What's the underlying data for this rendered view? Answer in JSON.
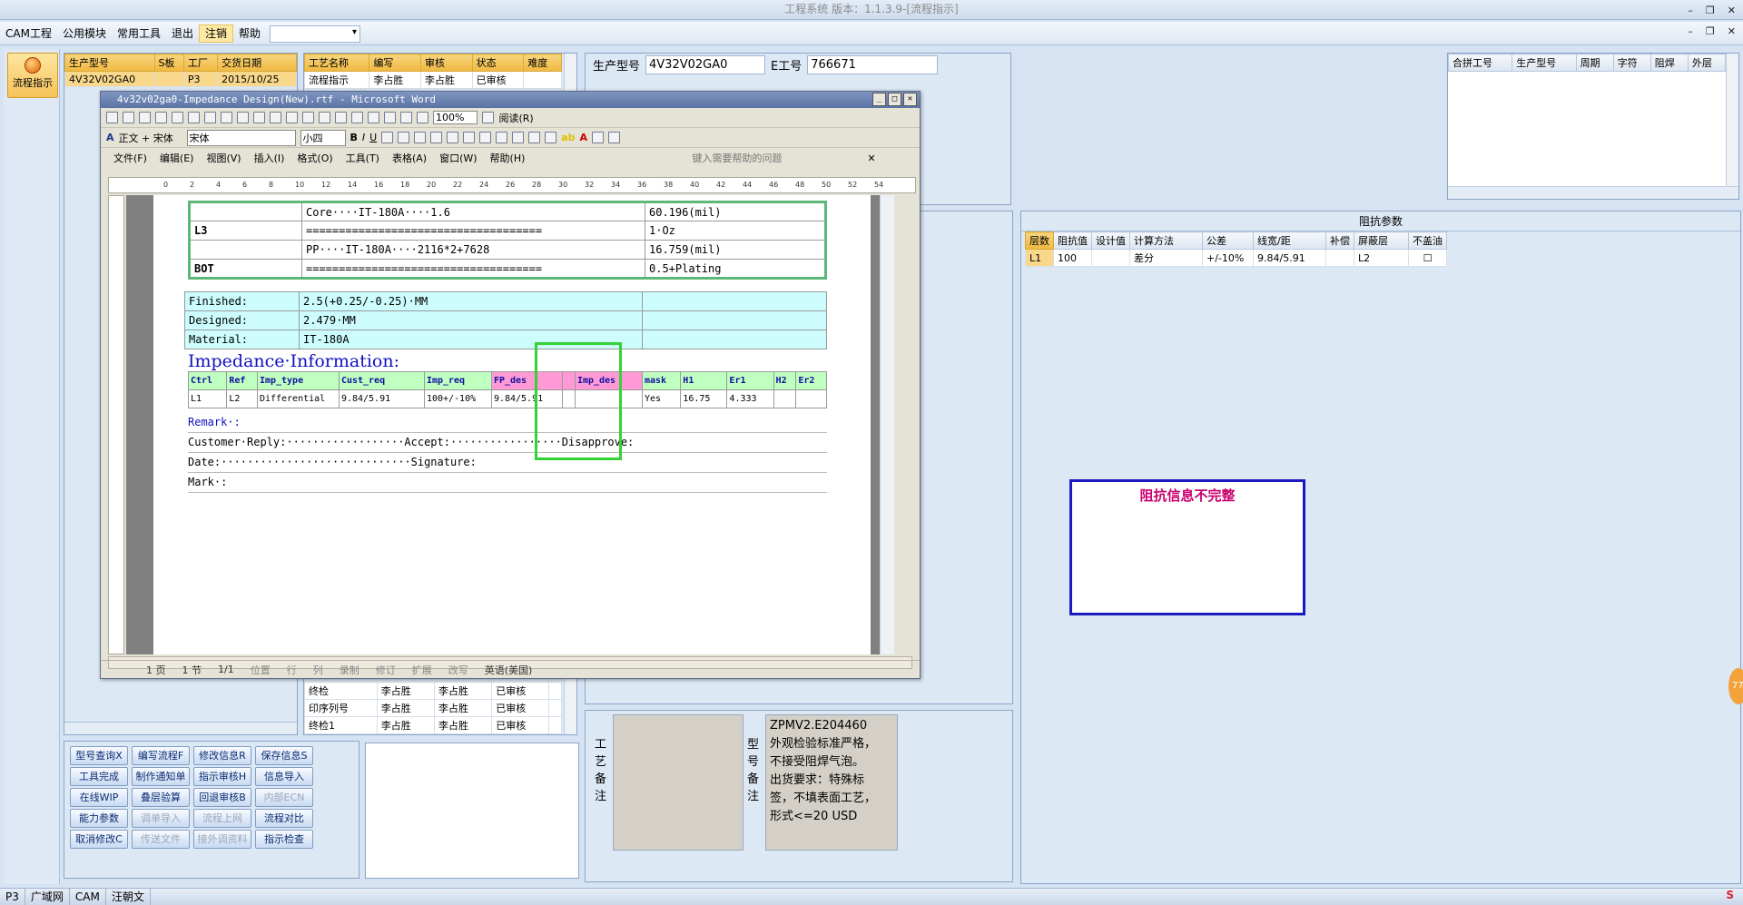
{
  "app": {
    "title": "工程系统 版本：1.1.3.9-[流程指示]"
  },
  "menu": {
    "items": [
      "CAM工程",
      "公用模块",
      "常用工具",
      "退出",
      "注销",
      "帮助"
    ],
    "active": "注销"
  },
  "nav": {
    "button": "流程指示"
  },
  "order_grid": {
    "headers": [
      "生产型号",
      "S板",
      "工厂",
      "交货日期"
    ],
    "row": [
      "4V32V02GA0",
      "",
      "P3",
      "2015/10/25"
    ]
  },
  "process_grid": {
    "headers": [
      "工艺名称",
      "编写",
      "审核",
      "状态",
      "难度"
    ],
    "top": [
      [
        "流程指示",
        "李占胜",
        "李占胜",
        "已审核",
        ""
      ]
    ],
    "bottom": [
      [
        "终检",
        "李占胜",
        "李占胜",
        "已审核",
        ""
      ],
      [
        "印序列号",
        "李占胜",
        "李占胜",
        "已审核",
        ""
      ],
      [
        "终检1",
        "李占胜",
        "李占胜",
        "已审核",
        ""
      ]
    ]
  },
  "buttons": [
    [
      "型号查询X",
      "编写流程F",
      "修改信息R",
      "保存信息S"
    ],
    [
      "工具完成",
      "制作通知单",
      "指示审核H",
      "信息导入"
    ],
    [
      "在线WIP",
      "叠层验算",
      "回退审核B",
      "内部ECN"
    ],
    [
      "能力参数",
      "调单导入",
      "流程上网",
      "流程对比"
    ],
    [
      "取消修改C",
      "传送文件",
      "接外调资料",
      "指示检查"
    ]
  ],
  "disabled_buttons": [
    "内部ECN",
    "调单导入",
    "流程上网",
    "传送文件",
    "接外调资料"
  ],
  "header_fields": {
    "model_label": "生产型号",
    "model_value": "4V32V02GA0",
    "eno_label": "E工号",
    "eno_value": "766671"
  },
  "merge_grid": {
    "headers": [
      "合拼工号",
      "生产型号",
      "周期",
      "字符",
      "阻焊",
      "外层"
    ]
  },
  "impedance_panel": {
    "title": "阻抗参数",
    "headers": [
      "层数",
      "阻抗值",
      "设计值",
      "计算方法",
      "公差",
      "线宽/距",
      "补偿",
      "屏蔽层",
      "不盖油"
    ],
    "row": [
      "L1",
      "100",
      "",
      "差分",
      "+/-10%",
      "9.84/5.91",
      "",
      "L2",
      ""
    ]
  },
  "warning": "阻抗信息不完整",
  "notes": {
    "process_label": "工艺备注",
    "model_label": "型号备注",
    "model_text": "ZPMV2.E204460\n外观检验标准严格，不接受阻焊气泡。\n出货要求：特殊标签，不填表面工艺，形式<=20 USD"
  },
  "word": {
    "title": "4v32v02ga0-Impedance Design(New).rtf - Microsoft Word",
    "menus": [
      "文件(F)",
      "编辑(E)",
      "视图(V)",
      "插入(I)",
      "格式(O)",
      "工具(T)",
      "表格(A)",
      "窗口(W)",
      "帮助(H)"
    ],
    "help_placeholder": "键入需要帮助的问题",
    "style": "正文 + 宋体",
    "font": "宋体",
    "size": "小四",
    "zoom": "100%",
    "read": "阅读(R)",
    "stack": [
      [
        "",
        "Core····IT-180A····1.6",
        "60.196(mil)"
      ],
      [
        "L3",
        "====================================",
        "1·Oz"
      ],
      [
        "",
        "PP····IT-180A····2116*2+7628",
        "16.759(mil)"
      ],
      [
        "BOT",
        "====================================",
        "0.5+Plating"
      ]
    ],
    "finish": [
      [
        "Finished:",
        "2.5(+0.25/-0.25)·MM",
        ""
      ],
      [
        "Designed:",
        "2.479·MM",
        ""
      ],
      [
        "Material:",
        "IT-180A",
        ""
      ]
    ],
    "imp_heading": "Impedance·Information:",
    "imp_headers": [
      "Ctrl",
      "Ref",
      "Imp_type",
      "Cust_req",
      "Imp_req",
      "FP_des",
      "",
      "Imp_des",
      "mask",
      "H1",
      "Er1",
      "H2",
      "Er2"
    ],
    "imp_row": [
      "L1",
      "L2",
      "Differential",
      "9.84/5.91",
      "100+/-10%",
      "9.84/5.91",
      "",
      "",
      "Yes",
      "16.75",
      "4.333",
      "",
      ""
    ],
    "remark": "Remark·:",
    "reply": "Customer·Reply:··················Accept:·················Disapprove:",
    "date": "Date:·····························Signature:",
    "mark": "Mark·:",
    "status": [
      "1 页",
      "1 节",
      "1/1",
      "位置",
      "行",
      "列",
      "录制",
      "修订",
      "扩展",
      "改写",
      "英语(美国)"
    ]
  },
  "taskbar": {
    "items": [
      "P3",
      "广域网",
      "CAM",
      "汪朝文"
    ]
  }
}
